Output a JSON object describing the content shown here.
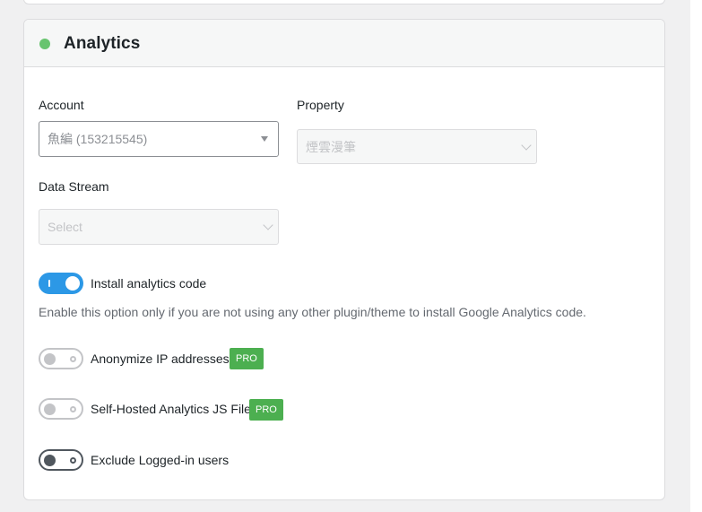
{
  "section": {
    "title": "Analytics",
    "status_color": "#68c46f"
  },
  "account": {
    "label": "Account",
    "value": "魚編 (153215545)"
  },
  "property": {
    "label": "Property",
    "value": "煙雲漫筆"
  },
  "data_stream": {
    "label": "Data Stream",
    "placeholder": "Select"
  },
  "install_code": {
    "label": "Install analytics code",
    "enabled": true,
    "help": "Enable this option only if you are not using any other plugin/theme to install Google Analytics code."
  },
  "anonymize_ip": {
    "label": "Anonymize IP addresses",
    "badge": "PRO",
    "enabled": false
  },
  "self_hosted": {
    "label": "Self-Hosted Analytics JS File",
    "badge": "PRO",
    "enabled": false
  },
  "exclude_logged_in": {
    "label": "Exclude Logged-in users",
    "enabled": false
  },
  "colors": {
    "accent": "#2c98e6",
    "pro_badge": "#4caf50",
    "status": "#68c46f"
  }
}
